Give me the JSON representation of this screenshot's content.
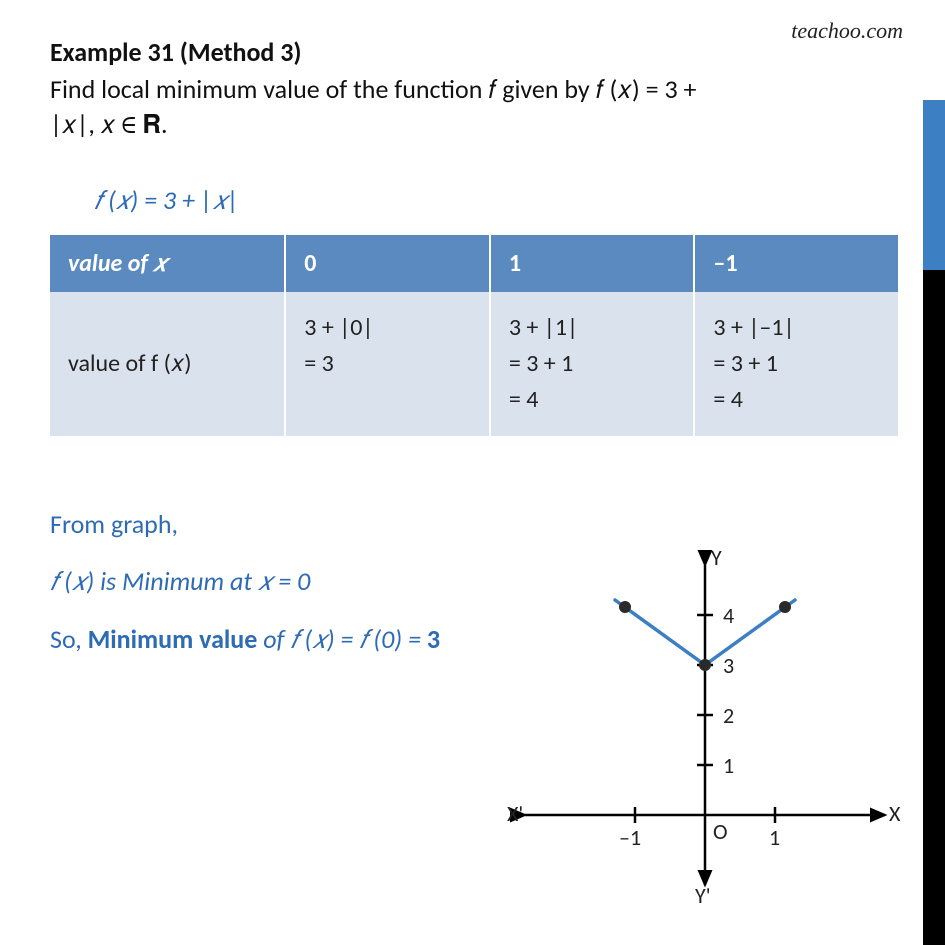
{
  "watermark": "teachoo.com",
  "title": "Example 31 (Method 3)",
  "question_line1": "Find local minimum value of the function 𝑓 given by 𝑓 (𝑥) = 3 +",
  "question_line2": "|𝑥|, 𝑥 ∈ 𝐑.",
  "equation": "𝑓 (𝑥) =  3 + |𝑥|",
  "table": {
    "header": [
      "value of 𝑥",
      "0",
      "1",
      "–1"
    ],
    "row_label": "value of f (𝑥)",
    "cell0_l1": "   3 + |0|",
    "cell0_l2": "= 3",
    "cell1_l1": "   3 + |1|",
    "cell1_l2": "= 3 + 1",
    "cell1_l3": "= 4",
    "cell2_l1": "   3 + |–1|",
    "cell2_l2": "= 3 + 1",
    "cell2_l3": "= 4"
  },
  "conclusion": {
    "l1": "From graph,",
    "l2_a": "𝑓 (𝑥) is Minimum at 𝑥  =  0",
    "l3_a": "So, ",
    "l3_b": "Minimum value",
    "l3_c": " of 𝑓 (𝑥) = 𝑓 (0) = ",
    "l3_d": "3"
  },
  "graph": {
    "y_ticks": [
      "4",
      "3",
      "2",
      "1"
    ],
    "x_ticks_neg": "–1",
    "x_ticks_pos": "1",
    "axis_X": "X",
    "axis_Xp": "X'",
    "axis_Y": "Y",
    "axis_Yp": "Y'",
    "origin": "O"
  },
  "chart_data": {
    "type": "line",
    "title": "f(x) = 3 + |x|",
    "xlabel": "x",
    "ylabel": "f(x)",
    "x": [
      -1,
      0,
      1
    ],
    "values": [
      4,
      3,
      4
    ],
    "ylim": [
      0,
      4
    ],
    "xlim": [
      -1.5,
      1.5
    ]
  }
}
